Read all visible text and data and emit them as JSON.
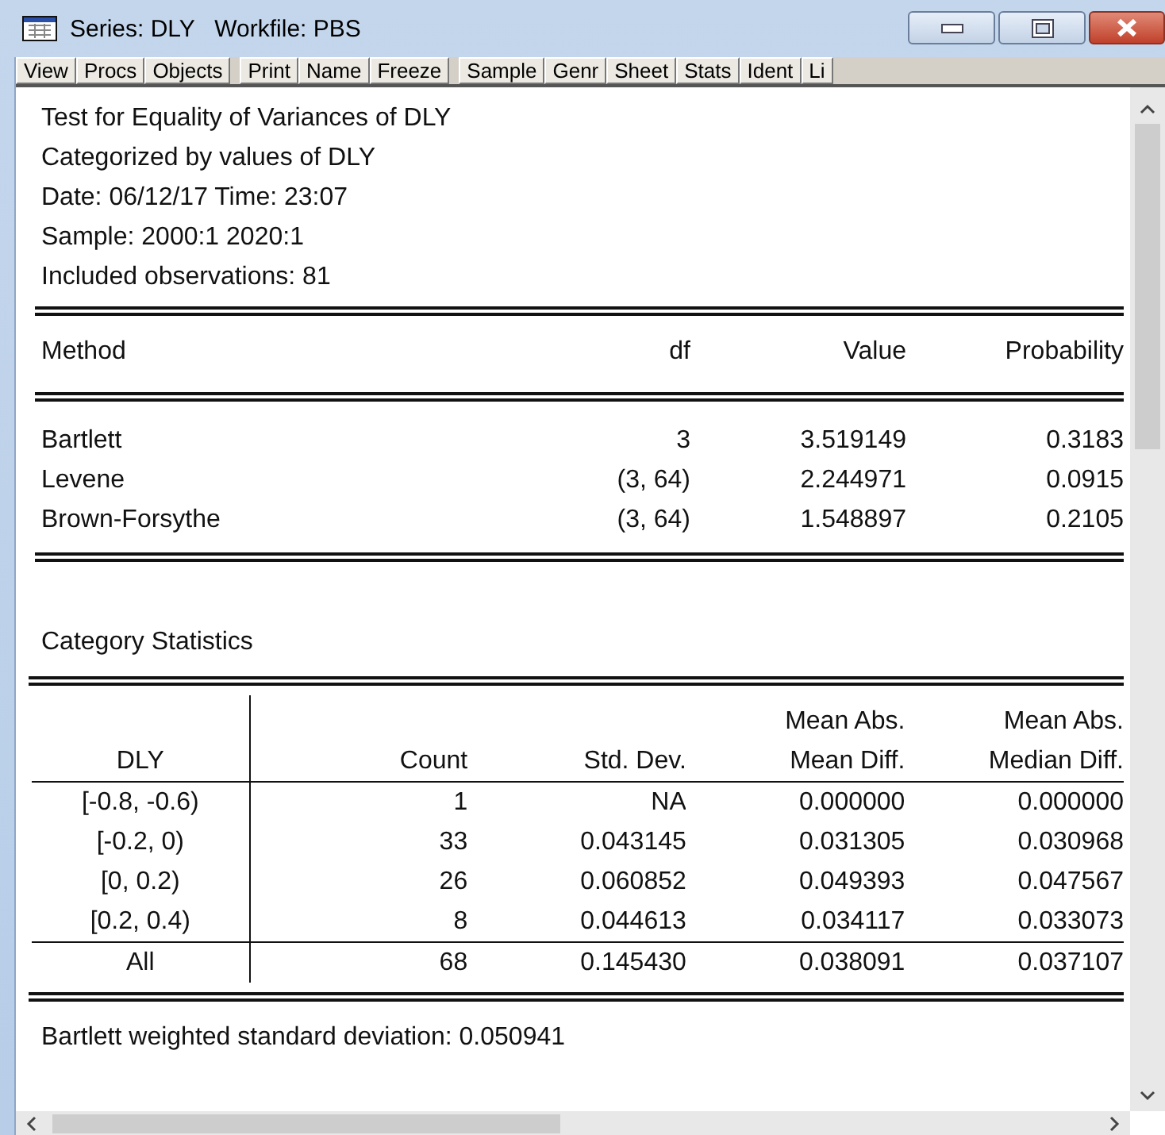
{
  "window": {
    "title": "Series: DLY   Workfile: PBS"
  },
  "toolbar": [
    [
      "View",
      "Procs",
      "Objects"
    ],
    [
      "Print",
      "Name",
      "Freeze"
    ],
    [
      "Sample",
      "Genr",
      "Sheet",
      "Stats",
      "Ident",
      "Li"
    ]
  ],
  "header_lines": [
    "Test for Equality of Variances of DLY",
    "Categorized by values of DLY",
    "Date: 06/12/17   Time: 23:07",
    "Sample: 2000:1 2020:1",
    "Included observations: 81"
  ],
  "tests": {
    "columns": [
      "Method",
      "df",
      "Value",
      "Probability"
    ],
    "rows": [
      [
        "Bartlett",
        "3",
        "3.519149",
        "0.3183"
      ],
      [
        "Levene",
        "(3, 64)",
        "2.244971",
        "0.0915"
      ],
      [
        "Brown-Forsythe",
        "(3, 64)",
        "1.548897",
        "0.2105"
      ]
    ]
  },
  "category_title": "Category Statistics",
  "categories": {
    "columns": [
      {
        "label": "DLY"
      },
      {
        "label": "Count"
      },
      {
        "label": "Std. Dev."
      },
      {
        "group": "Mean Abs.",
        "label": "Mean Diff."
      },
      {
        "group": "Mean Abs.",
        "label": "Median Diff."
      }
    ],
    "rows": [
      [
        "[-0.8, -0.6)",
        "1",
        "NA",
        "0.000000",
        "0.000000"
      ],
      [
        "[-0.2, 0)",
        "33",
        "0.043145",
        "0.031305",
        "0.030968"
      ],
      [
        "[0, 0.2)",
        "26",
        "0.060852",
        "0.049393",
        "0.047567"
      ],
      [
        "[0.2, 0.4)",
        "8",
        "0.044613",
        "0.034117",
        "0.033073"
      ]
    ],
    "total": [
      "All",
      "68",
      "0.145430",
      "0.038091",
      "0.037107"
    ]
  },
  "footer": "Bartlett weighted standard deviation:  0.050941"
}
